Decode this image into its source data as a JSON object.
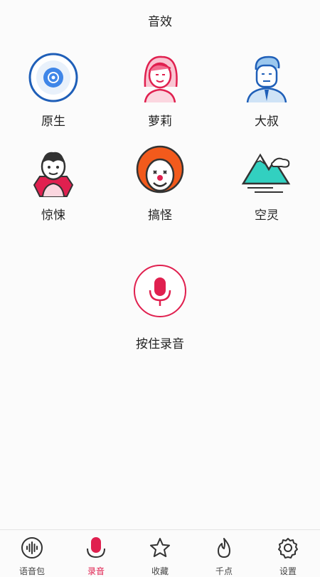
{
  "header": {
    "title": "音效"
  },
  "effects": [
    {
      "label": "原生",
      "icon": "vinyl-disc-icon"
    },
    {
      "label": "萝莉",
      "icon": "girl-avatar-icon"
    },
    {
      "label": "大叔",
      "icon": "man-avatar-icon"
    },
    {
      "label": "惊悚",
      "icon": "vampire-avatar-icon"
    },
    {
      "label": "搞怪",
      "icon": "clown-avatar-icon"
    },
    {
      "label": "空灵",
      "icon": "mountain-icon"
    }
  ],
  "record": {
    "label": "按住录音",
    "icon": "microphone-icon"
  },
  "tabs": [
    {
      "label": "语音包",
      "icon": "voice-wave-icon",
      "active": false
    },
    {
      "label": "录音",
      "icon": "microphone-icon",
      "active": true
    },
    {
      "label": "收藏",
      "icon": "star-icon",
      "active": false
    },
    {
      "label": "千点",
      "icon": "flame-icon",
      "active": false
    },
    {
      "label": "设置",
      "icon": "gear-icon",
      "active": false
    }
  ],
  "colors": {
    "accent": "#e0204f",
    "blue": "#2a6fd6",
    "pink": "#e84a73",
    "teal": "#32d0c0"
  }
}
